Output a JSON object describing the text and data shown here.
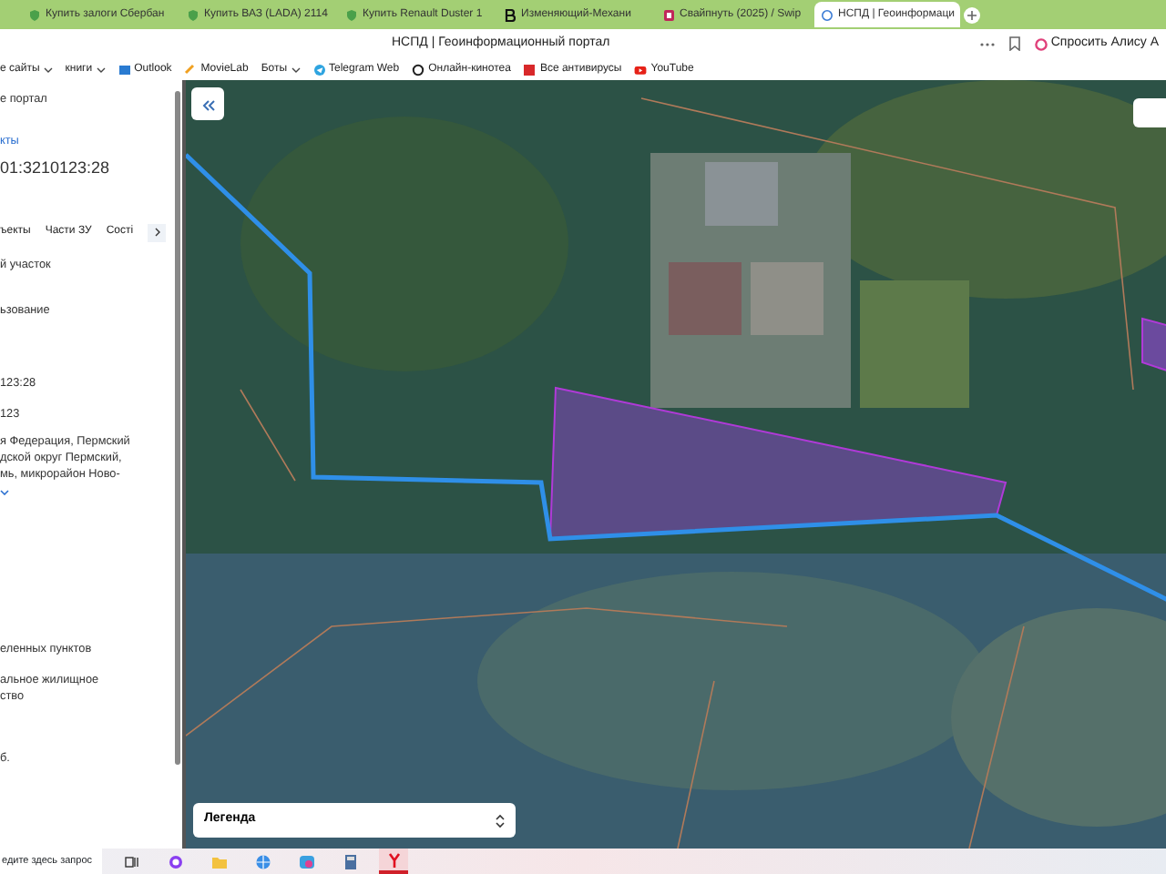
{
  "browser": {
    "tabs": [
      {
        "label": "Купить залоги Сбербан",
        "selected": false
      },
      {
        "label": "Купить ВАЗ (LADA) 2114",
        "selected": false
      },
      {
        "label": "Купить Renault Duster 1",
        "selected": false
      },
      {
        "label": "Изменяющий-Механи",
        "selected": false
      },
      {
        "label": "Свайпнуть (2025) / Swip",
        "selected": false
      },
      {
        "label": "НСПД | Геоинформаци",
        "selected": true
      }
    ],
    "page_title": "НСПД | Геоинформационный портал",
    "alice_button": "Спросить Алису А",
    "bookmarks": [
      {
        "label": "е сайты",
        "dropdown": true
      },
      {
        "label": "книги",
        "dropdown": true
      },
      {
        "label": "Outlook",
        "dropdown": false
      },
      {
        "label": "MovieLab",
        "dropdown": false
      },
      {
        "label": "Боты",
        "dropdown": true
      },
      {
        "label": "Telegram Web",
        "dropdown": false
      },
      {
        "label": "Онлайн-кинотеа",
        "dropdown": false
      },
      {
        "label": "Все антивирусы",
        "dropdown": false
      },
      {
        "label": "YouTube",
        "dropdown": false
      }
    ]
  },
  "side_panel": {
    "sections": [
      {
        "kind": "text",
        "lines": [
          "е портал"
        ]
      },
      {
        "kind": "link",
        "lines": [
          "кты"
        ]
      },
      {
        "kind": "heading",
        "lines": [
          "01:3210123:28"
        ]
      },
      {
        "kind": "tabs",
        "tabs": [
          {
            "label": "ъекты",
            "selected": false
          },
          {
            "label": "Части ЗУ",
            "selected": false
          },
          {
            "label": "Сості",
            "selected": false
          }
        ]
      },
      {
        "kind": "text",
        "lines": [
          "й участок"
        ]
      },
      {
        "kind": "text",
        "lines": [
          "ьзование"
        ]
      },
      {
        "kind": "text",
        "lines": [
          "123:28"
        ]
      },
      {
        "kind": "text",
        "lines": [
          "123"
        ]
      },
      {
        "kind": "address",
        "lines": [
          "я Федерация, Пермский",
          "дской округ Пермский,",
          "мь, микрорайон Ново-"
        ]
      },
      {
        "kind": "text",
        "lines": [
          "еленных пунктов"
        ]
      },
      {
        "kind": "text",
        "lines": [
          "альное жилищное",
          "ство"
        ]
      },
      {
        "kind": "text",
        "lines": [
          "б."
        ]
      }
    ]
  },
  "map": {
    "legend": "Легенда"
  },
  "taskbar": {
    "search": "едите здесь запрос",
    "apps": [
      {
        "active": false
      },
      {
        "active": false
      },
      {
        "active": false
      },
      {
        "active": false
      },
      {
        "active": false
      },
      {
        "active": false
      },
      {
        "active": true
      }
    ]
  }
}
